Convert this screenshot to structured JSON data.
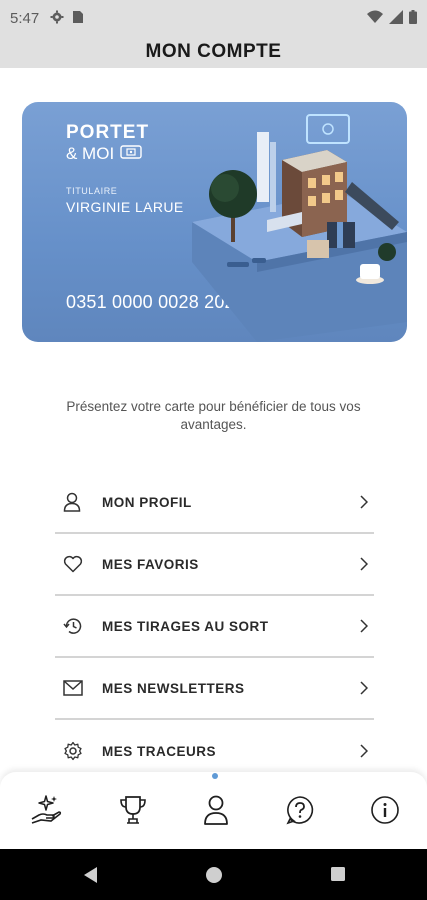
{
  "status_bar": {
    "time": "5:47"
  },
  "header": {
    "title": "MON COMPTE"
  },
  "card": {
    "brand_line1": "PORTET",
    "brand_line2": "& MOI",
    "holder_label": "TITULAIRE",
    "holder_name": "VIRGINIE LARUE",
    "number": "0351 0000 0028 2025",
    "color": "#6b93cc"
  },
  "intro_text": "Présentez votre carte pour bénéficier de tous vos avantages.",
  "menu": {
    "items": [
      {
        "label": "MON PROFIL",
        "icon": "user-icon"
      },
      {
        "label": "MES FAVORIS",
        "icon": "heart-icon"
      },
      {
        "label": "MES TIRAGES AU SORT",
        "icon": "history-icon"
      },
      {
        "label": "MES NEWSLETTERS",
        "icon": "mail-icon"
      },
      {
        "label": "MES TRACEURS",
        "icon": "gear-icon"
      }
    ]
  },
  "bottom_nav": {
    "items": [
      {
        "icon": "sparkle-hand-icon"
      },
      {
        "icon": "trophy-icon"
      },
      {
        "icon": "account-icon",
        "active": true
      },
      {
        "icon": "help-icon"
      },
      {
        "icon": "info-icon"
      }
    ],
    "accent": "#5f9ad6"
  }
}
